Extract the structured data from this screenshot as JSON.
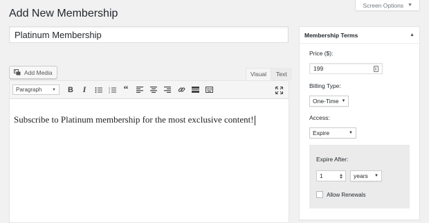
{
  "page": {
    "title": "Add New Membership"
  },
  "screen_options": {
    "label": "Screen Options"
  },
  "post": {
    "title_value": "Platinum Membership"
  },
  "editor": {
    "add_media_label": "Add Media",
    "tabs": [
      {
        "label": "Visual",
        "active": true
      },
      {
        "label": "Text",
        "active": false
      }
    ],
    "format_selected": "Paragraph",
    "toolbar_icons": [
      "bold-icon",
      "italic-icon",
      "bulleted-list-icon",
      "numbered-list-icon",
      "blockquote-icon",
      "align-left-icon",
      "align-center-icon",
      "align-right-icon",
      "link-icon",
      "read-more-icon",
      "toolbar-toggle-icon",
      "fullscreen-icon"
    ],
    "content": "Subscribe to Platinum membership for the most exclusive content!"
  },
  "membership_terms": {
    "heading": "Membership Terms",
    "price_label": "Price ($):",
    "price_value": "199",
    "billing_label": "Billing Type:",
    "billing_value": "One-Time",
    "access_label": "Access:",
    "access_value": "Expire",
    "expire_after_label": "Expire After:",
    "expire_number": "1",
    "expire_unit": "years",
    "allow_renewals_label": "Allow Renewals",
    "allow_renewals_checked": false
  },
  "colors": {
    "background": "#f1f1f1",
    "panel": "#ffffff",
    "expire_panel": "#ebebeb",
    "text": "#23282d"
  }
}
